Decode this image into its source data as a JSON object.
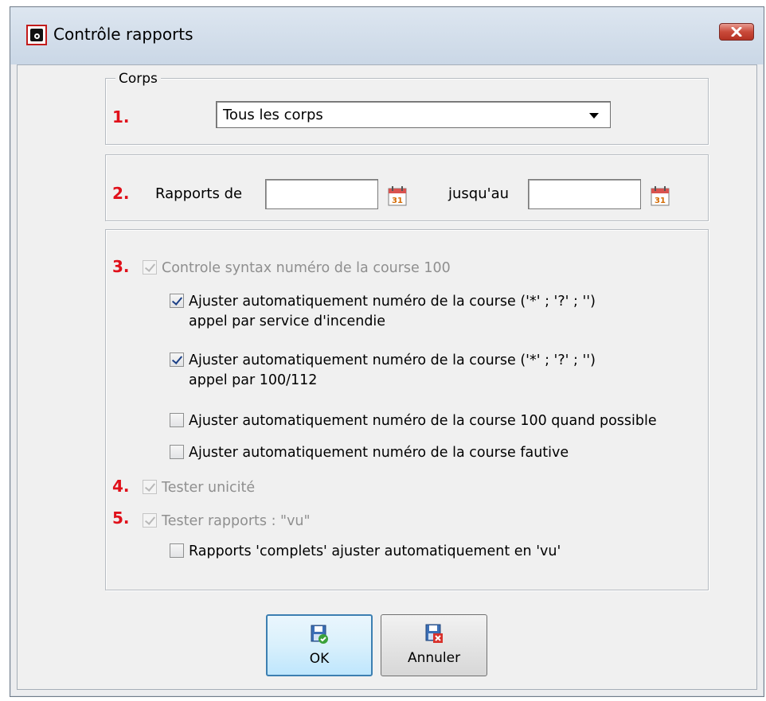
{
  "window": {
    "title": "Contrôle rapports"
  },
  "corps": {
    "legend": "Corps",
    "number": "1.",
    "selected": "Tous les corps"
  },
  "period": {
    "number": "2.",
    "from_label": "Rapports de",
    "from_value": "",
    "to_label": "jusqu'au",
    "to_value": ""
  },
  "checks": {
    "number3": "3.",
    "syntax": "Controle syntax numéro de la course 100",
    "adjust_fire_line1": "Ajuster automatiquement numéro de la course ('*' ; '?' ; '')",
    "adjust_fire_line2": "appel par service d'incendie",
    "adjust_112_line1": "Ajuster automatiquement numéro de la course ('*' ; '?' ; '')",
    "adjust_112_line2": "appel par 100/112",
    "adjust_100": "Ajuster automatiquement numéro de la course 100 quand possible",
    "adjust_faulty": "Ajuster automatiquement numéro de la course fautive",
    "number4": "4.",
    "unique": "Tester unicité",
    "number5": "5.",
    "seen": "Tester rapports : \"vu\"",
    "complete_seen": "Rapports 'complets'  ajuster automatiquement en 'vu'",
    "states": {
      "syntax": true,
      "adjust_fire": true,
      "adjust_112": true,
      "adjust_100": false,
      "adjust_faulty": false,
      "unique": true,
      "seen": true,
      "complete_seen": false
    }
  },
  "buttons": {
    "ok": "OK",
    "cancel": "Annuler"
  },
  "icons": {
    "app": "app-logo-icon",
    "close": "close-icon",
    "calendar": "calendar-icon",
    "save_ok": "save-ok-icon",
    "save_cancel": "save-cancel-icon"
  },
  "colors": {
    "step_numbers": "#e0101a",
    "close_button": "#c94a3a",
    "default_button_border": "#3c7fb1"
  }
}
